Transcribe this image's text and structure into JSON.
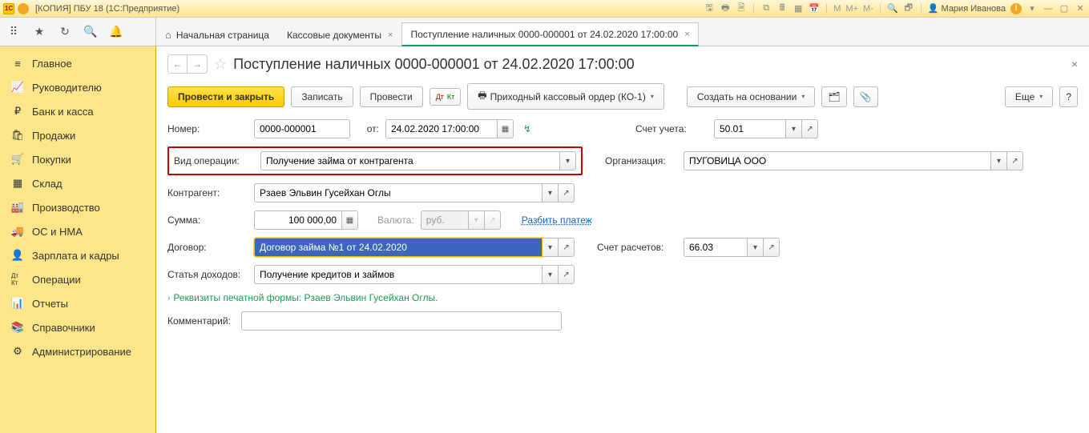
{
  "titlebar": {
    "app_title": "[КОПИЯ] ПБУ 18  (1С:Предприятие)",
    "m_labels": [
      "M",
      "M+",
      "M-"
    ],
    "user_name": "Мария Иванова"
  },
  "tabs": {
    "home_icon": "⌂",
    "home_label": "Начальная страница",
    "t1": "Кассовые документы",
    "t2": "Поступление наличных 0000-000001 от 24.02.2020 17:00:00"
  },
  "sidebar": [
    {
      "icon": "≡",
      "label": "Главное"
    },
    {
      "icon": "📈",
      "label": "Руководителю"
    },
    {
      "icon": "₽",
      "label": "Банк и касса"
    },
    {
      "icon": "🛍",
      "label": "Продажи"
    },
    {
      "icon": "🛒",
      "label": "Покупки"
    },
    {
      "icon": "▦",
      "label": "Склад"
    },
    {
      "icon": "🏭",
      "label": "Производство"
    },
    {
      "icon": "🚚",
      "label": "ОС и НМА"
    },
    {
      "icon": "👤",
      "label": "Зарплата и кадры"
    },
    {
      "icon": "Дт Кт",
      "label": "Операции"
    },
    {
      "icon": "📊",
      "label": "Отчеты"
    },
    {
      "icon": "📚",
      "label": "Справочники"
    },
    {
      "icon": "⚙",
      "label": "Администрирование"
    }
  ],
  "page": {
    "title": "Поступление наличных 0000-000001 от 24.02.2020 17:00:00"
  },
  "cmd": {
    "post_close": "Провести и закрыть",
    "write": "Записать",
    "post": "Провести",
    "print_order": "Приходный кассовый ордер (КО-1)",
    "create_based": "Создать на основании",
    "more": "Еще"
  },
  "form": {
    "number_label": "Номер:",
    "number_value": "0000-000001",
    "from_label": "от:",
    "date_value": "24.02.2020 17:00:00",
    "account_label": "Счет учета:",
    "account_value": "50.01",
    "optype_label": "Вид операции:",
    "optype_value": "Получение займа от контрагента",
    "org_label": "Организация:",
    "org_value": "ПУГОВИЦА ООО",
    "counterparty_label": "Контрагент:",
    "counterparty_value": "Рзаев Эльвин Гусейхан Оглы",
    "sum_label": "Сумма:",
    "sum_value": "100 000,00",
    "currency_label": "Валюта:",
    "currency_value": "руб.",
    "split_link": "Разбить платеж",
    "contract_label": "Договор:",
    "contract_value": "Договор займа №1 от 24.02.2020",
    "settle_label": "Счет расчетов:",
    "settle_value": "66.03",
    "income_label": "Статья доходов:",
    "income_value": "Получение кредитов и займов",
    "reqlabel": "Реквизиты печатной формы: Рзаев Эльвин Гусейхан Оглы.",
    "comment_label": "Комментарий:"
  }
}
